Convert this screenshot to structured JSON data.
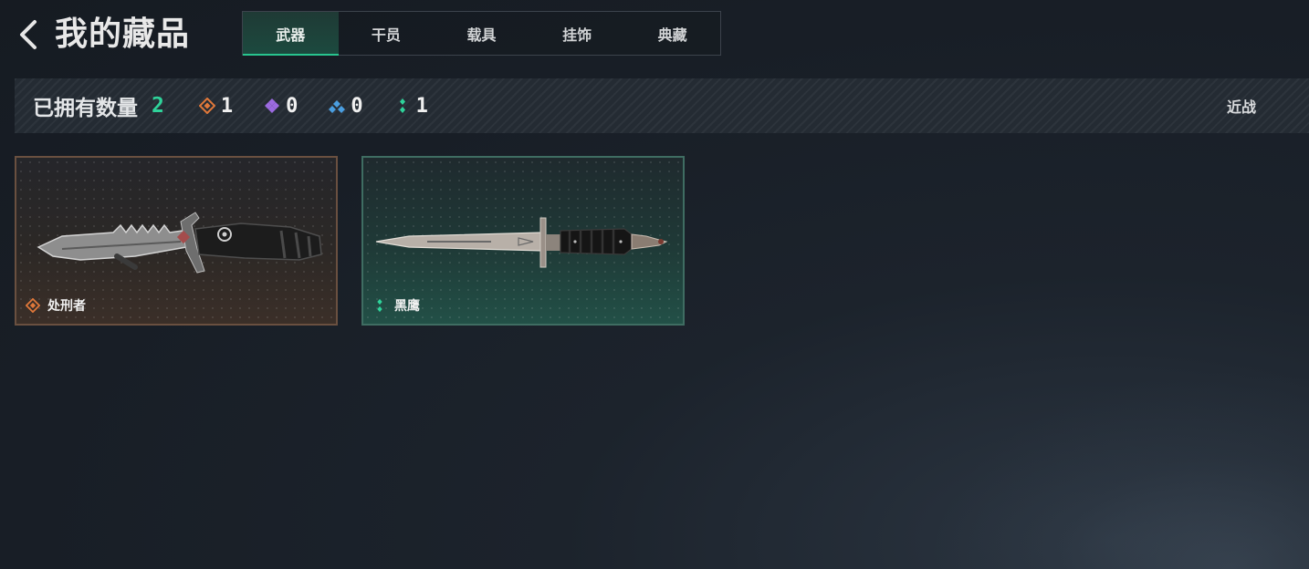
{
  "header": {
    "title": "我的藏品",
    "back_icon": "chevron-left-icon"
  },
  "tabs": [
    {
      "label": "武器",
      "active": true
    },
    {
      "label": "干员",
      "active": false
    },
    {
      "label": "载具",
      "active": false
    },
    {
      "label": "挂饰",
      "active": false
    },
    {
      "label": "典藏",
      "active": false
    }
  ],
  "summary": {
    "label": "已拥有数量",
    "total": "2",
    "rarities": [
      {
        "icon": "orange-diamond-icon",
        "color": "#e0783a",
        "count": "1"
      },
      {
        "icon": "purple-diamond-icon",
        "color": "#9b6ae0",
        "count": "0"
      },
      {
        "icon": "blue-diamond-icon",
        "color": "#4a9ee0",
        "count": "0"
      },
      {
        "icon": "green-diamond-icon",
        "color": "#2fd29a",
        "count": "1"
      }
    ],
    "filter_label": "近战"
  },
  "items": [
    {
      "name": "处刑者",
      "rarity_icon": "orange-diamond-icon",
      "rarity_color": "#e0783a",
      "image": "tactical-knife-image"
    },
    {
      "name": "黑鹰",
      "rarity_icon": "green-diamond-icon",
      "rarity_color": "#2fd29a",
      "image": "bayonet-knife-image"
    }
  ],
  "colors": {
    "accent": "#2fd29a",
    "background": "#1b222a"
  }
}
